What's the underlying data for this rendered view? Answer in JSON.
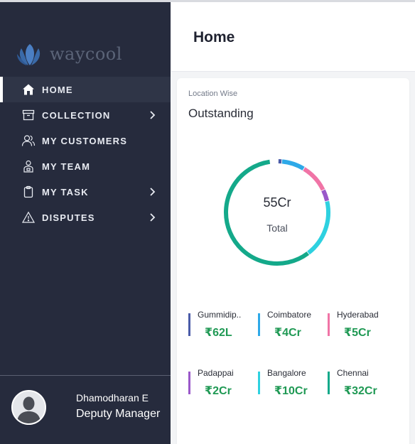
{
  "brand": {
    "name": "waycool"
  },
  "sidebar": {
    "items": [
      {
        "label": "HOME",
        "icon": "home-icon",
        "active": true,
        "has_submenu": false
      },
      {
        "label": "COLLECTION",
        "icon": "archive-box-icon",
        "active": false,
        "has_submenu": true
      },
      {
        "label": "MY CUSTOMERS",
        "icon": "users-icon",
        "active": false,
        "has_submenu": false
      },
      {
        "label": "MY TEAM",
        "icon": "team-member-icon",
        "active": false,
        "has_submenu": false
      },
      {
        "label": "MY TASK",
        "icon": "clipboard-icon",
        "active": false,
        "has_submenu": true
      },
      {
        "label": "DISPUTES",
        "icon": "warning-icon",
        "active": false,
        "has_submenu": true
      }
    ],
    "profile": {
      "name": "Dhamodharan E",
      "role": "Deputy Manager"
    }
  },
  "header": {
    "title": "Home"
  },
  "card": {
    "subtitle": "Location Wise",
    "title": "Outstanding",
    "total_value": "55Cr",
    "total_label": "Total",
    "segments": [
      {
        "name": "Gummidip..",
        "value": "₹62L",
        "share": 0.0113,
        "color": "#4a5ba8"
      },
      {
        "name": "Coimbatore",
        "value": "₹4Cr",
        "share": 0.0727,
        "color": "#2ea9e8"
      },
      {
        "name": "Hyderabad",
        "value": "₹5Cr",
        "share": 0.0909,
        "color": "#f074a6"
      },
      {
        "name": "Padappai",
        "value": "₹2Cr",
        "share": 0.0364,
        "color": "#9a58c9"
      },
      {
        "name": "Bangalore",
        "value": "₹10Cr",
        "share": 0.1818,
        "color": "#2ed1e0"
      },
      {
        "name": "Chennai",
        "value": "₹32Cr",
        "share": 0.5818,
        "color": "#14a98a"
      }
    ]
  },
  "colors": {
    "sidebar": "#262b3d",
    "accent_green": "#1f9954"
  }
}
